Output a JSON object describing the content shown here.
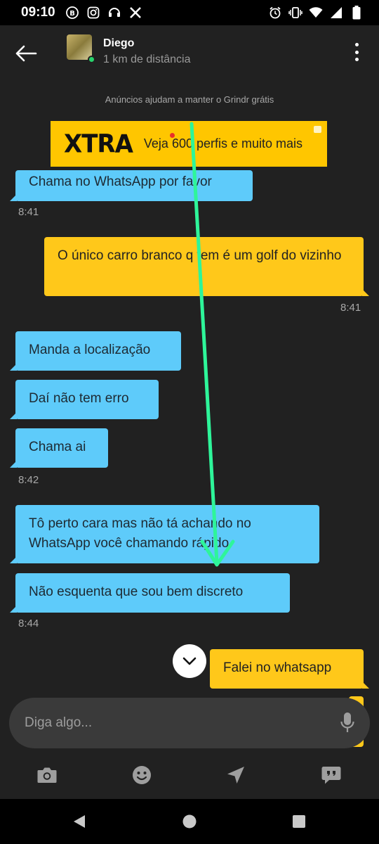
{
  "status_bar": {
    "time": "09:10",
    "left_icons": [
      "b-circle-icon",
      "instagram-icon",
      "headset-icon",
      "x-icon"
    ],
    "right_icons": [
      "alarm-icon",
      "vibrate-icon",
      "wifi-icon",
      "signal-icon",
      "battery-icon"
    ]
  },
  "header": {
    "contact_name": "Diego",
    "distance": "1 km de distância",
    "online": true
  },
  "ad": {
    "notice": "Anúncios ajudam a manter o Grindr grátis",
    "brand": "XTRA",
    "text": "Veja 600 perfis e muito mais"
  },
  "messages": [
    {
      "direction": "in",
      "text": "Chama no WhatsApp por favor"
    },
    {
      "direction": "in",
      "timestamp": "8:41"
    },
    {
      "direction": "out",
      "text": "O único carro branco q tem é um golf do vizinho"
    },
    {
      "direction": "out",
      "timestamp": "8:41"
    },
    {
      "direction": "in",
      "text": "Manda a localização"
    },
    {
      "direction": "in",
      "text": "Daí não tem erro"
    },
    {
      "direction": "in",
      "text": "Chama ai"
    },
    {
      "direction": "in",
      "timestamp": "8:42"
    },
    {
      "direction": "in",
      "text": "Tô perto cara mas não tá achando no WhatsApp você chamando rápido"
    },
    {
      "direction": "in",
      "text": "Não esquenta que sou bem discreto"
    },
    {
      "direction": "in",
      "timestamp": "8:44"
    },
    {
      "direction": "out",
      "text": "Falei no whatsapp"
    }
  ],
  "input": {
    "placeholder": "Diga algo..."
  },
  "toolbar": {
    "icons": [
      "camera-icon",
      "emoji-icon",
      "location-icon",
      "saved-phrases-icon"
    ]
  },
  "colors": {
    "incoming_bubble": "#5ecbfa",
    "outgoing_bubble": "#ffc81a",
    "background": "#212121",
    "annotation_arrow": "#2ef59a"
  }
}
